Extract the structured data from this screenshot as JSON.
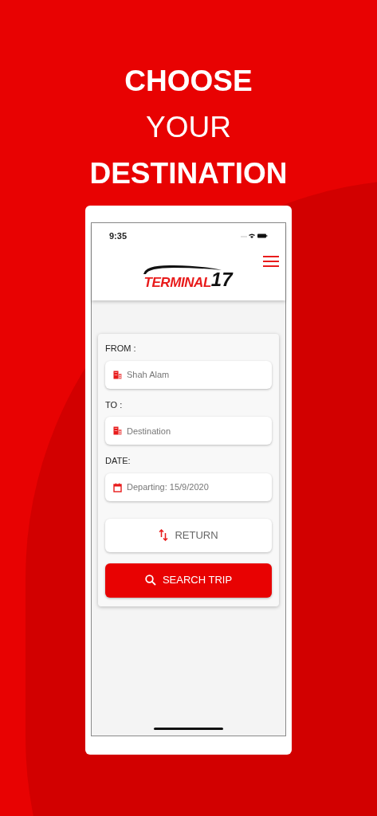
{
  "headline": [
    {
      "text": "CHOOSE",
      "bold": true
    },
    {
      "text": "YOUR",
      "bold": false
    },
    {
      "text": "DESTINATION",
      "bold": true
    }
  ],
  "status_bar": {
    "time": "9:35"
  },
  "header": {
    "logo": {
      "word": "TERMINAL",
      "number": "17"
    }
  },
  "form": {
    "fields": [
      {
        "label": "FROM :",
        "value": "Shah Alam",
        "kind": "location"
      },
      {
        "label": "TO :",
        "placeholder": "Destination",
        "kind": "location"
      },
      {
        "label": "DATE:",
        "value": "Departing: 15/9/2020",
        "kind": "date"
      }
    ],
    "return_button": "RETURN",
    "search_button": "SEARCH TRIP"
  }
}
